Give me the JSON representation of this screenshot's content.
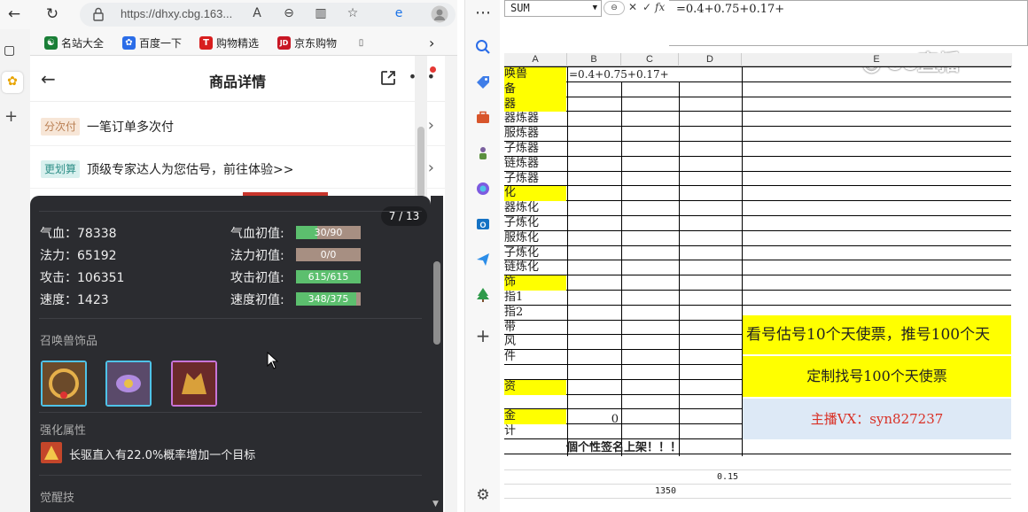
{
  "browser": {
    "url": "https://dhxy.cbg.163...",
    "favorites": [
      {
        "label": "名站大全",
        "color": "#1a7f37",
        "glyph": "☯"
      },
      {
        "label": "百度一下",
        "color": "#2b6de8",
        "glyph": "✿"
      },
      {
        "label": "购物精选",
        "color": "#d81e1e",
        "glyph": "T"
      },
      {
        "label": "京东购物",
        "color": "#c81623",
        "glyph": "JD"
      },
      {
        "label": "",
        "color": "#555555",
        "glyph": "▯"
      }
    ]
  },
  "page": {
    "title": "商品详情",
    "banners": [
      {
        "tag": "分次付",
        "tag_bg": "#f7e6d7",
        "tag_color": "#b97f52",
        "text": "一笔订单多次付"
      },
      {
        "tag": "更划算",
        "tag_bg": "#d8f0ee",
        "tag_color": "#2f8f88",
        "text": "顶级专家达人为您估号，前往体验>>"
      }
    ]
  },
  "popup": {
    "pager": "7 / 13",
    "stats_left": [
      {
        "label": "气血：78338"
      },
      {
        "label": "法力：65192"
      },
      {
        "label": "攻击：106351"
      },
      {
        "label": "速度：1423"
      }
    ],
    "stats_right": [
      {
        "label": "气血初值:",
        "bar": "30/90",
        "fill": 0.33
      },
      {
        "label": "法力初值:",
        "bar": "0/0",
        "fill": 0
      },
      {
        "label": "攻击初值:",
        "bar": "615/615",
        "fill": 1
      },
      {
        "label": "速度初值:",
        "bar": "348/375",
        "fill": 0.93
      }
    ],
    "section_accessories": "召唤兽饰品",
    "section_enhance": "强化属性",
    "enhance_text": "长驱直入有22.0%概率增加一个目标",
    "section_awaken": "觉醒技",
    "item_frame_colors": [
      "#4fc3e8",
      "#4fc3e8",
      "#c874d8"
    ]
  },
  "sheet": {
    "namebox": "SUM",
    "formula": "=0.4+0.75+0.17+",
    "watermark": "CC直播",
    "columns": [
      "A",
      "B",
      "C",
      "D",
      "E"
    ],
    "col_a": [
      "唤兽",
      "备",
      "器",
      "器炼器",
      "服炼器",
      "子炼器",
      "链炼器",
      "子炼器",
      "化",
      "器炼化",
      "子炼化",
      "服炼化",
      "子炼化",
      "链炼化",
      "饰",
      "指1",
      "指2",
      "带",
      "风",
      "件",
      "",
      "资",
      "",
      "金",
      "计"
    ],
    "b1_formula": "=0.4+0.75+0.17+",
    "b_total": "0",
    "banner_1": "看号估号10个天使票，推号100个天",
    "banner_2": "定制找号100个天使票",
    "banner_3": "主播VX：syn827237",
    "sign_text": "個个性签名上架！！！",
    "val_015": "0.15",
    "val_1350": "1350"
  }
}
